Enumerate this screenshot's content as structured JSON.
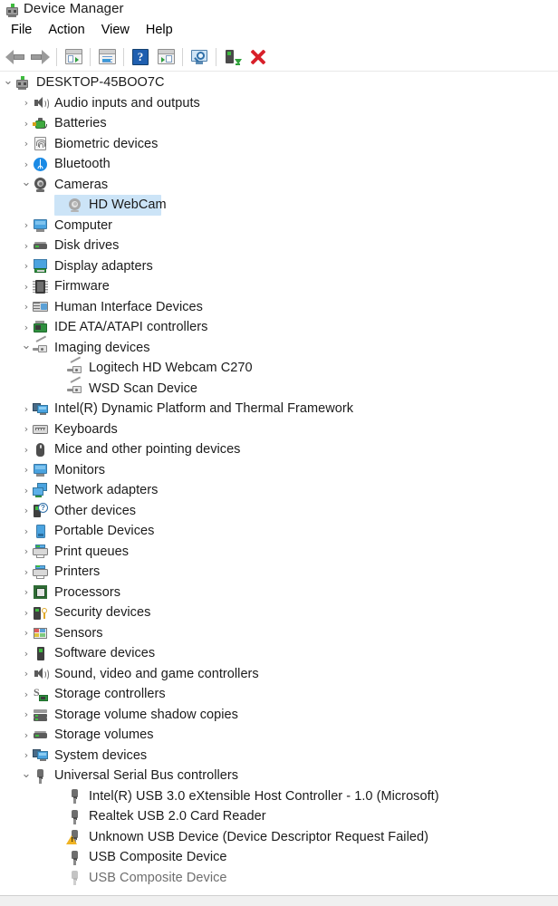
{
  "window": {
    "title": "Device Manager",
    "title_icon": "device-manager-icon"
  },
  "menu": {
    "items": [
      {
        "label": "File",
        "name": "menu-file"
      },
      {
        "label": "Action",
        "name": "menu-action"
      },
      {
        "label": "View",
        "name": "menu-view"
      },
      {
        "label": "Help",
        "name": "menu-help"
      }
    ]
  },
  "toolbar": {
    "buttons": [
      {
        "name": "back-button",
        "icon": "arrow-left-icon",
        "tooltip": "Back"
      },
      {
        "name": "forward-button",
        "icon": "arrow-right-icon",
        "tooltip": "Forward"
      },
      {
        "name": "show-hide-console-tree-button",
        "icon": "console-tree-icon",
        "tooltip": "Show/Hide Console Tree"
      },
      {
        "name": "properties-button",
        "icon": "properties-icon",
        "tooltip": "Properties"
      },
      {
        "name": "help-button",
        "icon": "help-question-icon",
        "tooltip": "Help"
      },
      {
        "name": "update-driver-button",
        "icon": "update-driver-window-icon",
        "tooltip": "Update driver"
      },
      {
        "name": "scan-for-hardware-changes-button",
        "icon": "scan-hardware-icon",
        "tooltip": "Scan for hardware changes"
      },
      {
        "name": "enable-device-button",
        "icon": "enable-device-icon",
        "tooltip": "Enable device"
      },
      {
        "name": "uninstall-device-button",
        "icon": "uninstall-device-icon",
        "tooltip": "Uninstall device"
      }
    ]
  },
  "tree": {
    "nodes": [
      {
        "label": "DESKTOP-45BOO7C",
        "level": 0,
        "expander": "expanded",
        "icon": "computer-root-icon",
        "selected": false,
        "dim": false
      },
      {
        "label": "Audio inputs and outputs",
        "level": 1,
        "expander": "collapsed",
        "icon": "speaker-icon",
        "selected": false,
        "dim": false
      },
      {
        "label": "Batteries",
        "level": 1,
        "expander": "collapsed",
        "icon": "battery-icon",
        "selected": false,
        "dim": false
      },
      {
        "label": "Biometric devices",
        "level": 1,
        "expander": "collapsed",
        "icon": "fingerprint-icon",
        "selected": false,
        "dim": false
      },
      {
        "label": "Bluetooth",
        "level": 1,
        "expander": "collapsed",
        "icon": "bluetooth-icon",
        "selected": false,
        "dim": false
      },
      {
        "label": "Cameras",
        "level": 1,
        "expander": "expanded",
        "icon": "camera-icon",
        "selected": false,
        "dim": false
      },
      {
        "label": "HD WebCam",
        "level": 2,
        "expander": "none",
        "icon": "camera-icon",
        "selected": true,
        "dim": false
      },
      {
        "label": "Computer",
        "level": 1,
        "expander": "collapsed",
        "icon": "monitor-icon",
        "selected": false,
        "dim": false
      },
      {
        "label": "Disk drives",
        "level": 1,
        "expander": "collapsed",
        "icon": "disk-drive-icon",
        "selected": false,
        "dim": false
      },
      {
        "label": "Display adapters",
        "level": 1,
        "expander": "collapsed",
        "icon": "display-adapter-icon",
        "selected": false,
        "dim": false
      },
      {
        "label": "Firmware",
        "level": 1,
        "expander": "collapsed",
        "icon": "chip-icon",
        "selected": false,
        "dim": false
      },
      {
        "label": "Human Interface Devices",
        "level": 1,
        "expander": "collapsed",
        "icon": "hid-icon",
        "selected": false,
        "dim": false
      },
      {
        "label": "IDE ATA/ATAPI controllers",
        "level": 1,
        "expander": "collapsed",
        "icon": "controller-card-icon",
        "selected": false,
        "dim": false
      },
      {
        "label": "Imaging devices",
        "level": 1,
        "expander": "expanded",
        "icon": "imaging-device-icon",
        "selected": false,
        "dim": false
      },
      {
        "label": "Logitech HD Webcam C270",
        "level": 2,
        "expander": "none",
        "icon": "imaging-device-icon",
        "selected": false,
        "dim": false
      },
      {
        "label": "WSD Scan Device",
        "level": 2,
        "expander": "none",
        "icon": "imaging-device-icon",
        "selected": false,
        "dim": false
      },
      {
        "label": "Intel(R) Dynamic Platform and Thermal Framework",
        "level": 1,
        "expander": "collapsed",
        "icon": "two-monitor-icon",
        "selected": false,
        "dim": false
      },
      {
        "label": "Keyboards",
        "level": 1,
        "expander": "collapsed",
        "icon": "keyboard-icon",
        "selected": false,
        "dim": false
      },
      {
        "label": "Mice and other pointing devices",
        "level": 1,
        "expander": "collapsed",
        "icon": "mouse-icon",
        "selected": false,
        "dim": false
      },
      {
        "label": "Monitors",
        "level": 1,
        "expander": "collapsed",
        "icon": "monitor-icon",
        "selected": false,
        "dim": false
      },
      {
        "label": "Network adapters",
        "level": 1,
        "expander": "collapsed",
        "icon": "network-adapter-icon",
        "selected": false,
        "dim": false
      },
      {
        "label": "Other devices",
        "level": 1,
        "expander": "collapsed",
        "icon": "other-device-icon",
        "selected": false,
        "dim": false
      },
      {
        "label": "Portable Devices",
        "level": 1,
        "expander": "collapsed",
        "icon": "portable-device-icon",
        "selected": false,
        "dim": false
      },
      {
        "label": "Print queues",
        "level": 1,
        "expander": "collapsed",
        "icon": "printer-icon",
        "selected": false,
        "dim": false
      },
      {
        "label": "Printers",
        "level": 1,
        "expander": "collapsed",
        "icon": "printer-icon",
        "selected": false,
        "dim": false
      },
      {
        "label": "Processors",
        "level": 1,
        "expander": "collapsed",
        "icon": "processor-icon",
        "selected": false,
        "dim": false
      },
      {
        "label": "Security devices",
        "level": 1,
        "expander": "collapsed",
        "icon": "security-device-icon",
        "selected": false,
        "dim": false
      },
      {
        "label": "Sensors",
        "level": 1,
        "expander": "collapsed",
        "icon": "sensor-icon",
        "selected": false,
        "dim": false
      },
      {
        "label": "Software devices",
        "level": 1,
        "expander": "collapsed",
        "icon": "software-device-icon",
        "selected": false,
        "dim": false
      },
      {
        "label": "Sound, video and game controllers",
        "level": 1,
        "expander": "collapsed",
        "icon": "speaker-icon",
        "selected": false,
        "dim": false
      },
      {
        "label": "Storage controllers",
        "level": 1,
        "expander": "collapsed",
        "icon": "storage-controller-icon",
        "selected": false,
        "dim": false
      },
      {
        "label": "Storage volume shadow copies",
        "level": 1,
        "expander": "collapsed",
        "icon": "shadow-copy-icon",
        "selected": false,
        "dim": false
      },
      {
        "label": "Storage volumes",
        "level": 1,
        "expander": "collapsed",
        "icon": "disk-drive-icon",
        "selected": false,
        "dim": false
      },
      {
        "label": "System devices",
        "level": 1,
        "expander": "collapsed",
        "icon": "two-monitor-icon",
        "selected": false,
        "dim": false
      },
      {
        "label": "Universal Serial Bus controllers",
        "level": 1,
        "expander": "expanded",
        "icon": "usb-icon",
        "selected": false,
        "dim": false
      },
      {
        "label": "Intel(R) USB 3.0 eXtensible Host Controller - 1.0 (Microsoft)",
        "level": 2,
        "expander": "none",
        "icon": "usb-icon",
        "selected": false,
        "dim": false
      },
      {
        "label": "Realtek USB 2.0 Card Reader",
        "level": 2,
        "expander": "none",
        "icon": "usb-icon",
        "selected": false,
        "dim": false
      },
      {
        "label": "Unknown USB Device (Device Descriptor Request Failed)",
        "level": 2,
        "expander": "none",
        "icon": "usb-warning-icon",
        "selected": false,
        "dim": false
      },
      {
        "label": "USB Composite Device",
        "level": 2,
        "expander": "none",
        "icon": "usb-icon",
        "selected": false,
        "dim": false
      },
      {
        "label": "USB Composite Device",
        "level": 2,
        "expander": "none",
        "icon": "usb-disabled-icon",
        "selected": false,
        "dim": true
      }
    ],
    "glyphs": {
      "expanded": "⌄",
      "collapsed": "›"
    }
  },
  "colors": {
    "selection": "#cce4f7",
    "text": "#1b1b1b",
    "chevron": "#767676",
    "accent_blue": "#1a8ae5",
    "warning_yellow": "#f0b323",
    "delete_red": "#d8202a",
    "green": "#3fbb3f",
    "background": "#ffffff"
  }
}
